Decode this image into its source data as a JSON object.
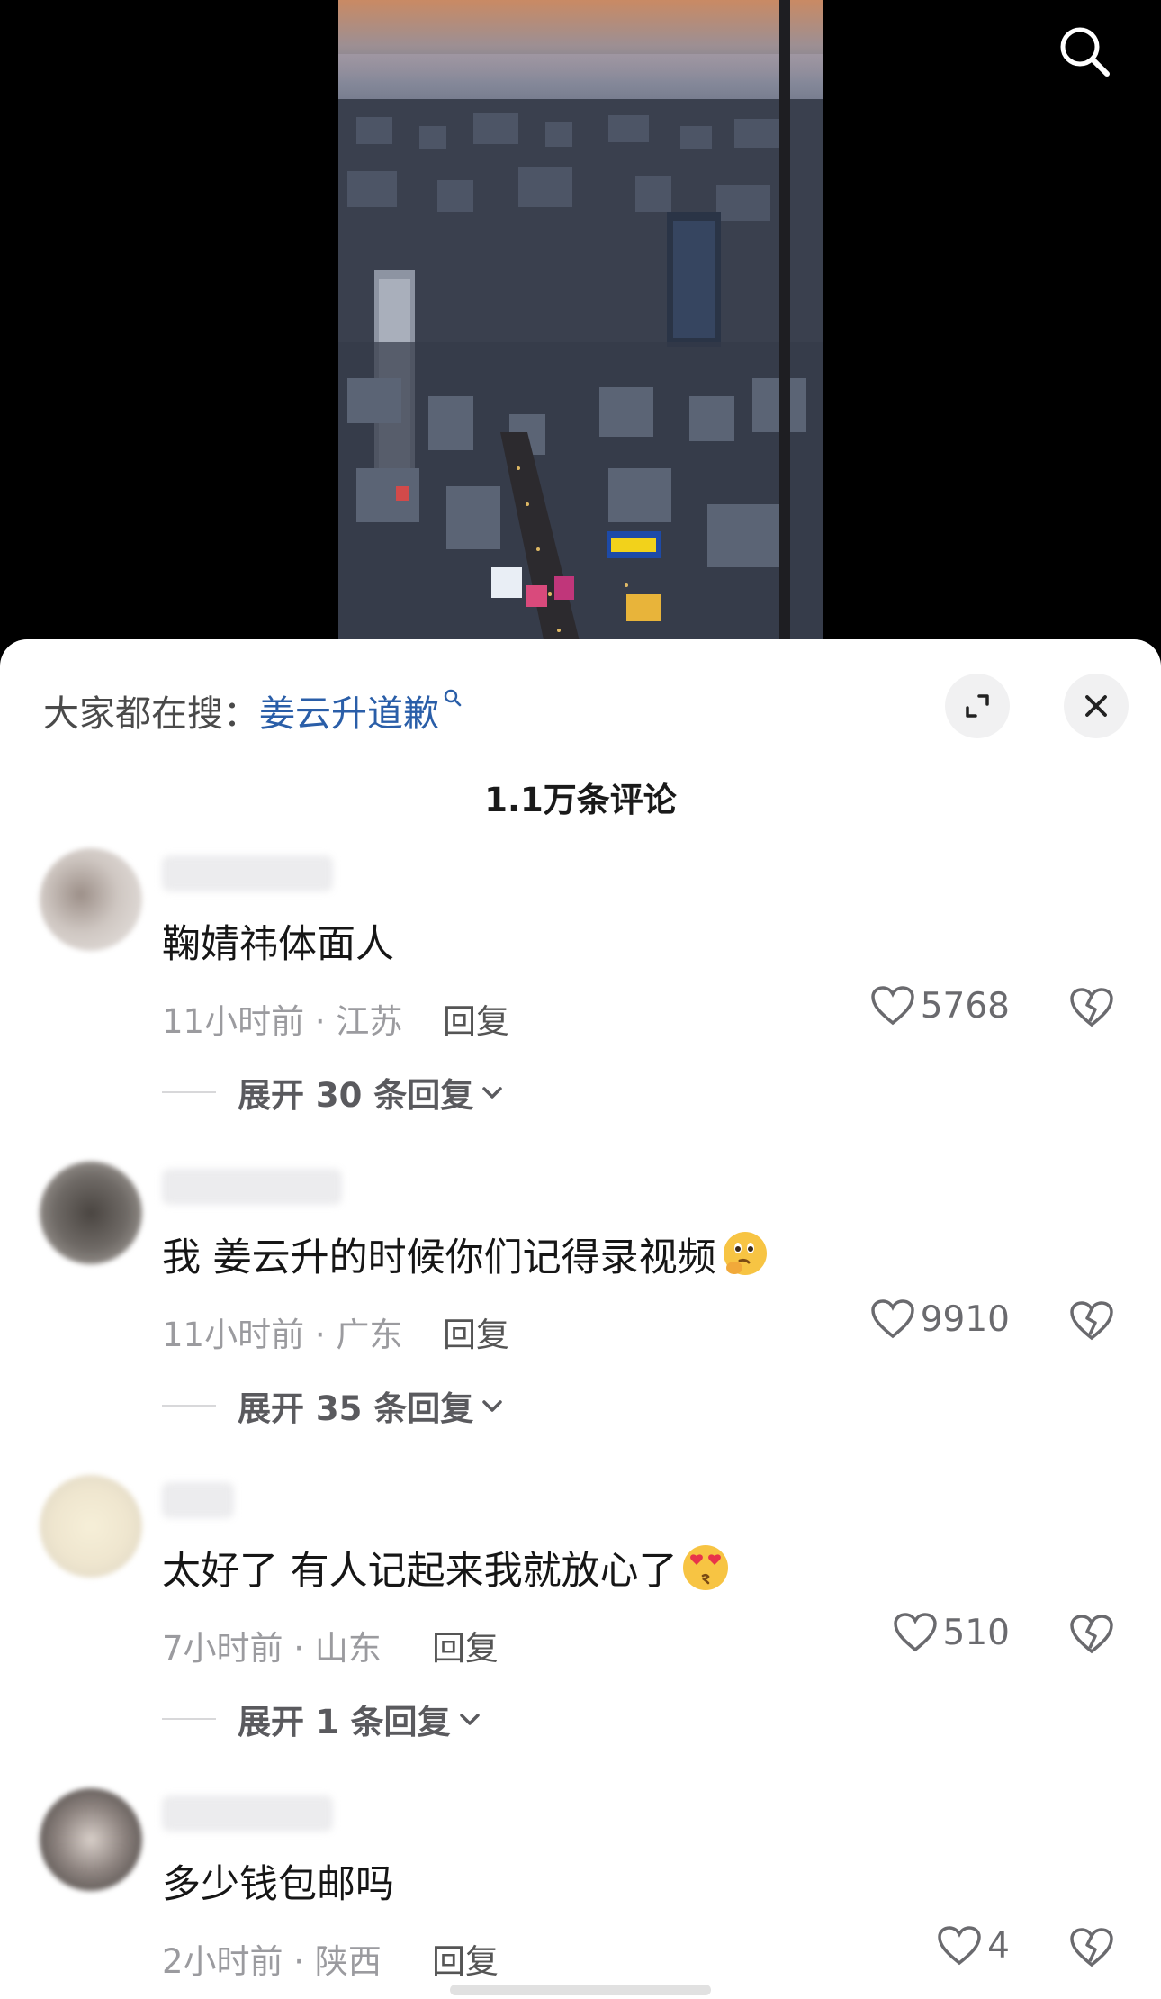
{
  "hot_search": {
    "prefix": "大家都在搜：",
    "keyword": "姜云升道歉"
  },
  "comments_header": {
    "count": "1.1万条评论"
  },
  "comments": [
    {
      "text": "鞠婧祎体面人",
      "emoji": "",
      "time": "11小时前",
      "location": "江苏",
      "reply_label": "回复",
      "likes": "5768",
      "expand_label": "展开 30 条回复"
    },
    {
      "text": "我 姜云升的时候你们记得录视频",
      "emoji": "thinking-face",
      "time": "11小时前",
      "location": "广东",
      "reply_label": "回复",
      "likes": "9910",
      "expand_label": "展开 35 条回复"
    },
    {
      "text": "太好了 有人记起来我就放心了",
      "emoji": "heart-eyes-face",
      "time": "7小时前",
      "location": "山东",
      "reply_label": "回复",
      "likes": "510",
      "expand_label": "展开 1 条回复"
    },
    {
      "text": "多少钱包邮吗",
      "emoji": "",
      "time": "2小时前",
      "location": "陕西",
      "reply_label": "回复",
      "likes": "4",
      "expand_label": ""
    }
  ],
  "colors": {
    "keyword_blue": "#2a5ea8",
    "meta_gray": "#9b9b9f",
    "text_dark": "#161616"
  }
}
